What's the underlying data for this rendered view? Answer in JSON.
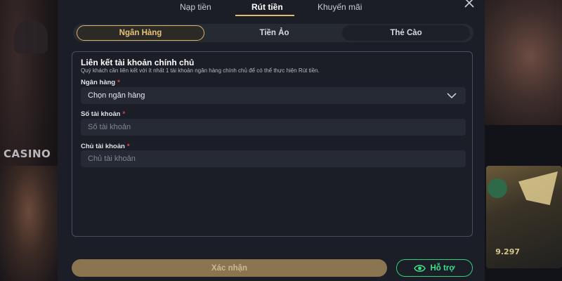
{
  "background": {
    "casino_label": "CASINO",
    "promo_amount": "9.297"
  },
  "tabs": [
    {
      "label": "Nạp tiền",
      "active": false
    },
    {
      "label": "Rút tiền",
      "active": true
    },
    {
      "label": "Khuyến mãi",
      "active": false
    }
  ],
  "subtabs": [
    {
      "label": "Ngân Hàng",
      "active": true
    },
    {
      "label": "Tiền Ảo",
      "active": false
    },
    {
      "label": "Thẻ Cào",
      "active": false
    }
  ],
  "form": {
    "title": "Liên kết tài khoản chính chủ",
    "description": "Quý khách cần liên kết với ít nhất 1 tài khoản ngân hàng chính chủ để có thể thực hiện Rút tiền.",
    "bank": {
      "label": "Ngân hàng",
      "required_mark": "*",
      "selected": "Chọn ngân hàng"
    },
    "account_number": {
      "label": "Số tài khoản",
      "required_mark": "*",
      "value": "",
      "placeholder": "Số tài khoản"
    },
    "account_holder": {
      "label": "Chủ tài khoản",
      "required_mark": "*",
      "value": "",
      "placeholder": "Chủ tài khoản"
    }
  },
  "actions": {
    "confirm_label": "Xác nhận",
    "support_label": "Hỗ trợ"
  },
  "icons": {
    "close": "close-icon",
    "chevron": "chevron-down-icon",
    "support": "eye-support-icon"
  },
  "colors": {
    "accent_gold": "#d9b66c",
    "support_green": "#2fd07b",
    "required_red": "#e0454a"
  }
}
